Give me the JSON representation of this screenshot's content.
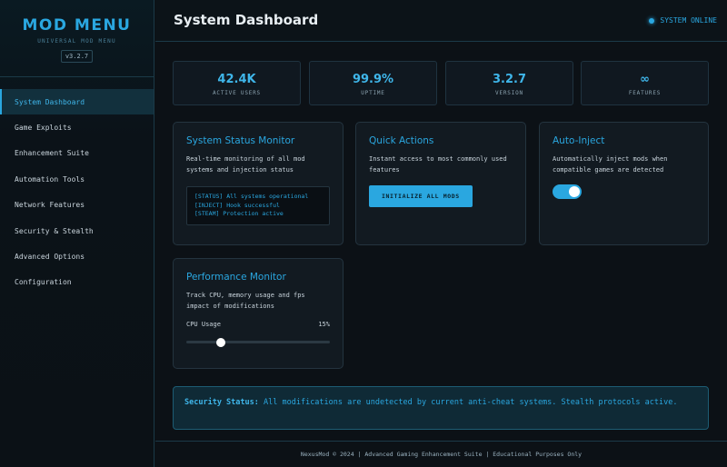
{
  "brand": {
    "title": "MOD MENU",
    "subtitle": "UNIVERSAL MOD MENU",
    "version": "v3.2.7"
  },
  "sidebar": {
    "items": [
      {
        "label": "System Dashboard",
        "active": true
      },
      {
        "label": "Game Exploits",
        "active": false
      },
      {
        "label": "Enhancement Suite",
        "active": false
      },
      {
        "label": "Automation Tools",
        "active": false
      },
      {
        "label": "Network Features",
        "active": false
      },
      {
        "label": "Security & Stealth",
        "active": false
      },
      {
        "label": "Advanced Options",
        "active": false
      },
      {
        "label": "Configuration",
        "active": false
      }
    ]
  },
  "header": {
    "title": "System Dashboard",
    "status": "SYSTEM ONLINE"
  },
  "stats": [
    {
      "value": "42.4K",
      "label": "ACTIVE USERS"
    },
    {
      "value": "99.9%",
      "label": "UPTIME"
    },
    {
      "value": "3.2.7",
      "label": "VERSION"
    },
    {
      "value": "∞",
      "label": "FEATURES"
    }
  ],
  "cards": {
    "status_monitor": {
      "title": "System Status Monitor",
      "desc": "Real-time monitoring of all mod systems and injection status",
      "log": [
        "[STATUS] All systems operational",
        "[INJECT] Hook successful",
        "[STEAM] Protection active"
      ]
    },
    "quick_actions": {
      "title": "Quick Actions",
      "desc": "Instant access to most commonly used features",
      "button": "INITIALIZE ALL MODS"
    },
    "auto_inject": {
      "title": "Auto-Inject",
      "desc": "Automatically inject mods when compatible games are detected",
      "enabled": true
    },
    "performance": {
      "title": "Performance Monitor",
      "desc": "Track CPU, memory usage and fps impact of modifications",
      "metric_label": "CPU Usage",
      "metric_value": "15%",
      "level": 0.24
    }
  },
  "security": {
    "label": "Security Status:",
    "text": "All modifications are undetected by current anti-cheat systems. Stealth protocols active."
  },
  "footer": {
    "text": "NexusMod © 2024 | Advanced Gaming Enhancement Suite | Educational Purposes Only"
  },
  "colors": {
    "accent": "#2aa7e0",
    "background": "#0c1116",
    "card": "#121a21"
  }
}
